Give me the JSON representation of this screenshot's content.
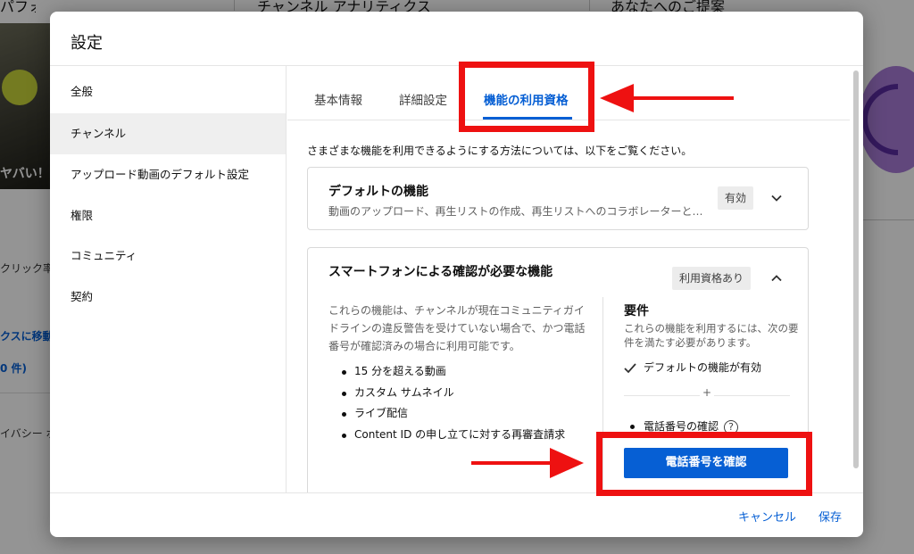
{
  "background": {
    "header_left": "パフォーマンス",
    "header_center": "チャンネル アナリティクス",
    "header_right": "あなたへのご提案",
    "thumb_text": "ヤバい！",
    "text_click": "クリック率",
    "link_text": "クスに移動",
    "count_text": "0 件)",
    "privacy_text": "イバシー ポ"
  },
  "dialog": {
    "title": "設定",
    "sidebar": {
      "items": [
        {
          "label": "全般"
        },
        {
          "label": "チャンネル"
        },
        {
          "label": "アップロード動画のデフォルト設定"
        },
        {
          "label": "権限"
        },
        {
          "label": "コミュニティ"
        },
        {
          "label": "契約"
        }
      ],
      "active_index": 1
    },
    "tabs": [
      {
        "label": "基本情報"
      },
      {
        "label": "詳細設定"
      },
      {
        "label": "機能の利用資格"
      }
    ],
    "active_tab_index": 2,
    "intro": "さまざまな機能を利用できるようにする方法については、以下をご覧ください。",
    "default_features": {
      "title": "デフォルトの機能",
      "subtitle": "動画のアップロード、再生リストの作成、再生リストへのコラボレーターと…",
      "badge": "有効",
      "icon": "chevron-down-icon"
    },
    "phone_features": {
      "title": "スマートフォンによる確認が必要な機能",
      "badge": "利用資格あり",
      "icon": "chevron-up-icon",
      "description": "これらの機能は、チャンネルが現在コミュニティガイドラインの違反警告を受けていない場合で、かつ電話番号が確認済みの場合に利用可能です。",
      "features": [
        "15 分を超える動画",
        "カスタム サムネイル",
        "ライブ配信",
        "Content ID の申し立てに対する再審査請求"
      ],
      "requirements": {
        "title": "要件",
        "description": "これらの機能を利用するには、次の要件を満たす必要があります。",
        "check_item": "デフォルトの機能が有効",
        "plus": "+",
        "phone_item": "電話番号の確認",
        "help_icon": "?",
        "verify_button": "電話番号を確認"
      }
    },
    "footer": {
      "cancel": "キャンセル",
      "save": "保存"
    }
  },
  "annotation_color": "#ee1111",
  "accent": "#065fd4"
}
